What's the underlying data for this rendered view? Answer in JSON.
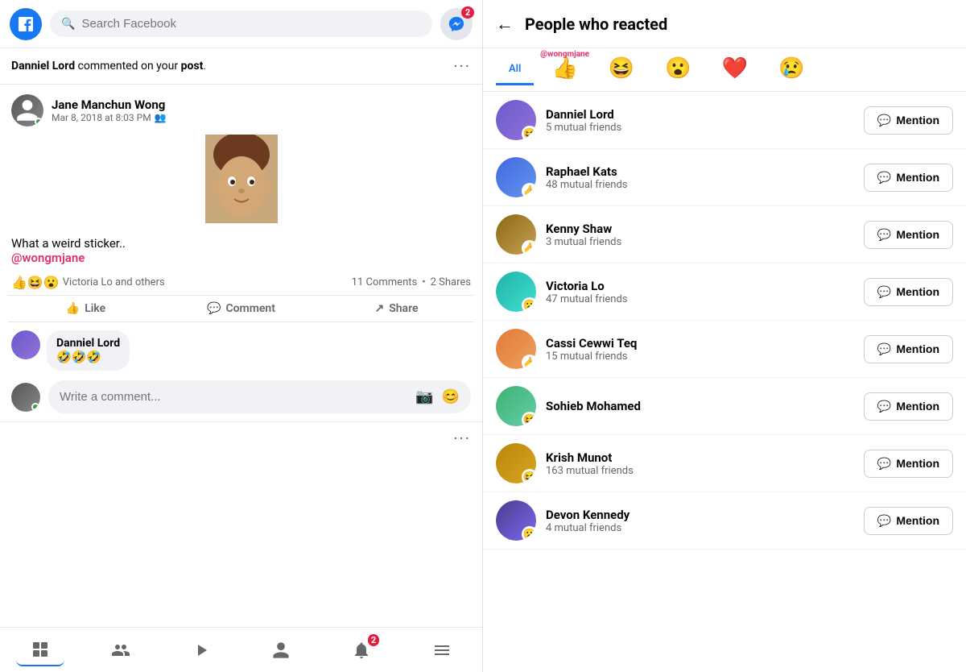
{
  "left": {
    "search_placeholder": "Search Facebook",
    "messenger_badge": "2",
    "notification": {
      "text_before": "Danniel Lord",
      "text_middle": " commented on your ",
      "text_bold": "post",
      "text_after": "."
    },
    "post": {
      "author": "Jane Manchun Wong",
      "time": "Mar 8, 2018 at 8:03 PM",
      "text": "What a weird sticker..",
      "mention": "@wongmjane",
      "reactions_text": "Victoria Lo and others",
      "comments_count": "11 Comments",
      "shares_count": "2 Shares"
    },
    "actions": {
      "like": "Like",
      "comment": "Comment",
      "share": "Share"
    },
    "comment": {
      "author": "Danniel Lord",
      "text": "🤣🤣🤣"
    },
    "comment_input_placeholder": "Write a comment...",
    "bottom_nav": {
      "badge": "2"
    }
  },
  "right": {
    "title": "People who reacted",
    "tabs": [
      {
        "label": "All",
        "emoji": "",
        "active": true,
        "mention_tag": ""
      },
      {
        "label": "",
        "emoji": "👍",
        "active": false,
        "mention_tag": "@wongmjane"
      },
      {
        "label": "",
        "emoji": "😆",
        "active": false,
        "mention_tag": ""
      },
      {
        "label": "",
        "emoji": "😮",
        "active": false,
        "mention_tag": ""
      },
      {
        "label": "",
        "emoji": "❤️",
        "active": false,
        "mention_tag": ""
      },
      {
        "label": "",
        "emoji": "😢",
        "active": false,
        "mention_tag": ""
      }
    ],
    "people": [
      {
        "name": "Danniel Lord",
        "mutual": "5 mutual friends",
        "reaction": "😆",
        "av_class": "av-purple"
      },
      {
        "name": "Raphael Kats",
        "mutual": "48 mutual friends",
        "reaction": "👍",
        "av_class": "av-blue"
      },
      {
        "name": "Kenny Shaw",
        "mutual": "3 mutual friends",
        "reaction": "👍",
        "av_class": "av-brown"
      },
      {
        "name": "Victoria Lo",
        "mutual": "47 mutual friends",
        "reaction": "😮",
        "av_class": "av-teal"
      },
      {
        "name": "Cassi Cewwi Teq",
        "mutual": "15 mutual friends",
        "reaction": "👍",
        "av_class": "av-orange"
      },
      {
        "name": "Sohieb Mohamed",
        "mutual": "",
        "reaction": "😆",
        "av_class": "av-green"
      },
      {
        "name": "Krish Munot",
        "mutual": "163 mutual friends",
        "reaction": "😆",
        "av_class": "av-gold"
      },
      {
        "name": "Devon Kennedy",
        "mutual": "4 mutual friends",
        "reaction": "😮",
        "av_class": "av-indigo"
      }
    ],
    "mention_label": "Mention"
  }
}
